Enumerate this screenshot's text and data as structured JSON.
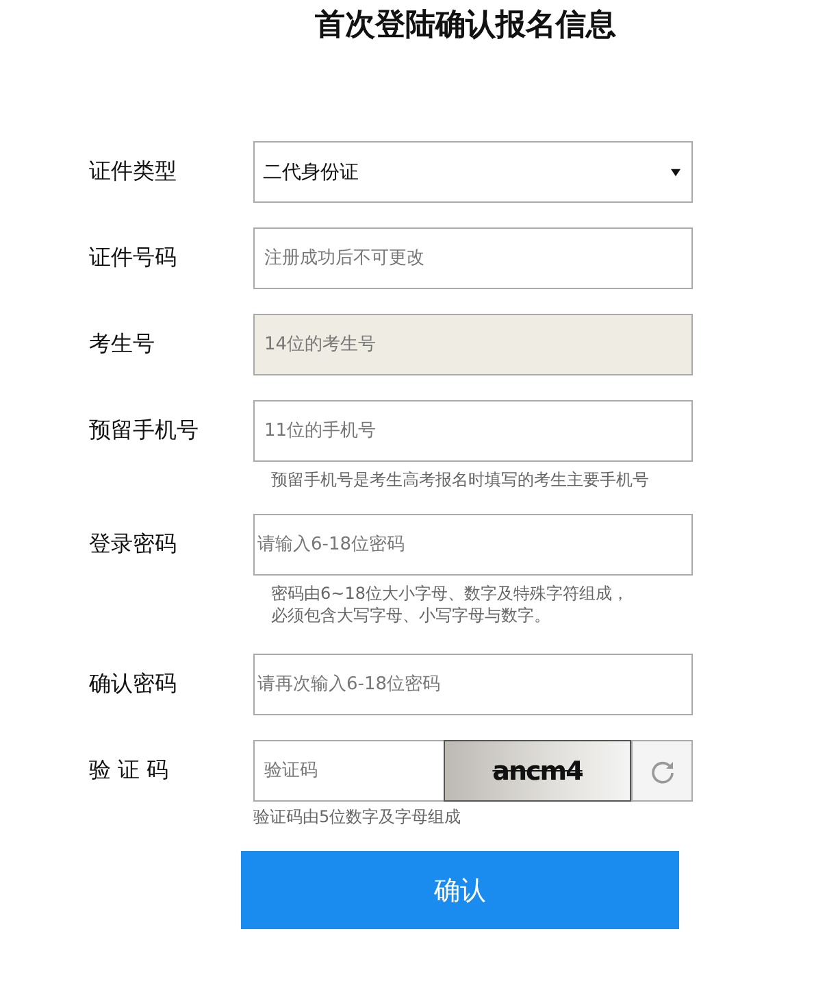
{
  "title": "首次登陆确认报名信息",
  "fields": [
    {
      "kind": "select",
      "label": "证件类型",
      "value": "二代身份证",
      "disabled": false
    },
    {
      "kind": "text",
      "label": "证件号码",
      "placeholder": "注册成功后不可更改",
      "disabled": false
    },
    {
      "kind": "text",
      "label": "考生号",
      "placeholder": "14位的考生号",
      "disabled": true
    },
    {
      "kind": "text",
      "label": "预留手机号",
      "placeholder": "11位的手机号",
      "disabled": false,
      "hint": [
        "预留手机号是考生高考报名时填写的考生主要手机号"
      ]
    },
    {
      "kind": "password",
      "label": "登录密码",
      "placeholder": "请输入6-18位密码",
      "disabled": false,
      "hint": [
        "密码由6~18位大小字母、数字及特殊字符组成，",
        "必须包含大写字母、小写字母与数字。"
      ]
    },
    {
      "kind": "password",
      "label": "确认密码",
      "placeholder": "请再次输入6-18位密码",
      "disabled": false
    },
    {
      "kind": "captcha",
      "label": "验 证 码",
      "placeholder": "验证码",
      "captcha": "ancm4",
      "disabled": false,
      "hint": [
        "验证码由5位数字及字母组成"
      ]
    }
  ],
  "submit": "确认"
}
